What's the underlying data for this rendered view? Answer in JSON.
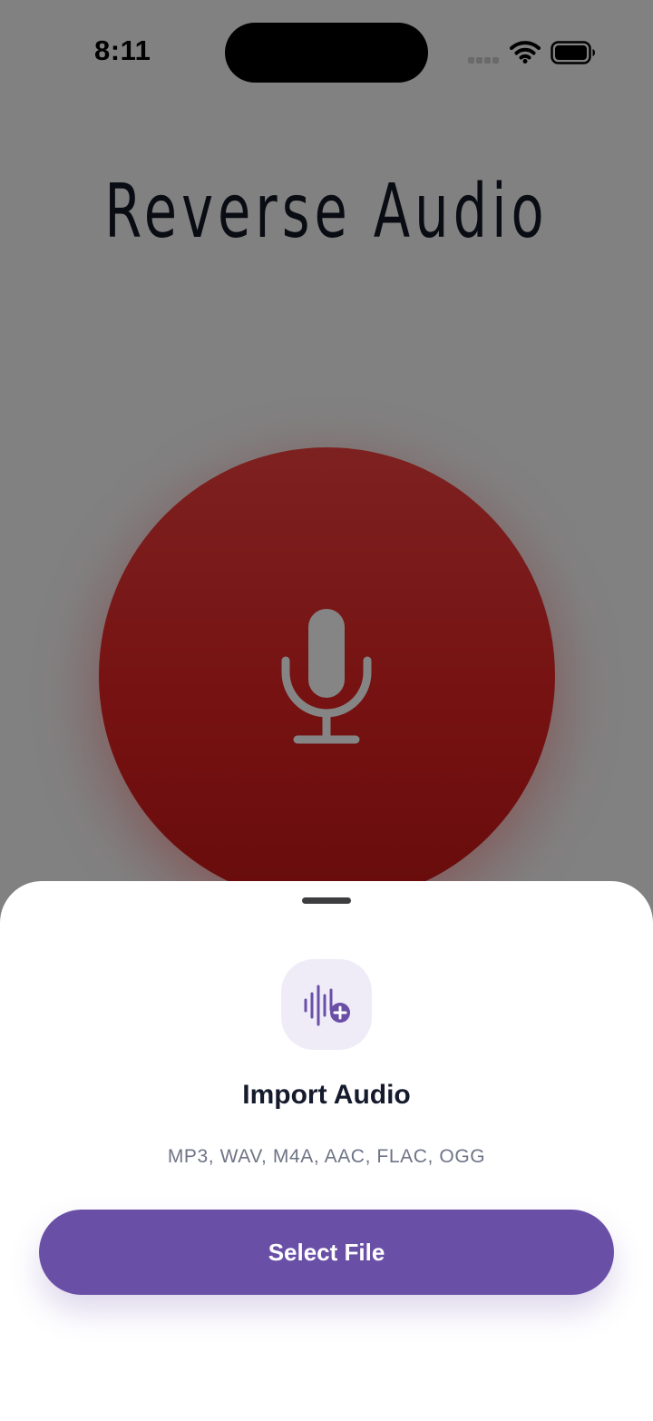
{
  "status_bar": {
    "time": "8:11",
    "icons": [
      "cellular-signal-icon",
      "wifi-icon",
      "battery-icon"
    ]
  },
  "app": {
    "title": "Reverse Audio",
    "record_button_icon": "microphone-icon",
    "record_color": "#e32323"
  },
  "import_sheet": {
    "icon": "audio-waveform-plus-icon",
    "title": "Import Audio",
    "formats": "MP3, WAV, M4A, AAC, FLAC, OGG",
    "select_button_label": "Select File",
    "accent_color": "#6a4fa7"
  }
}
